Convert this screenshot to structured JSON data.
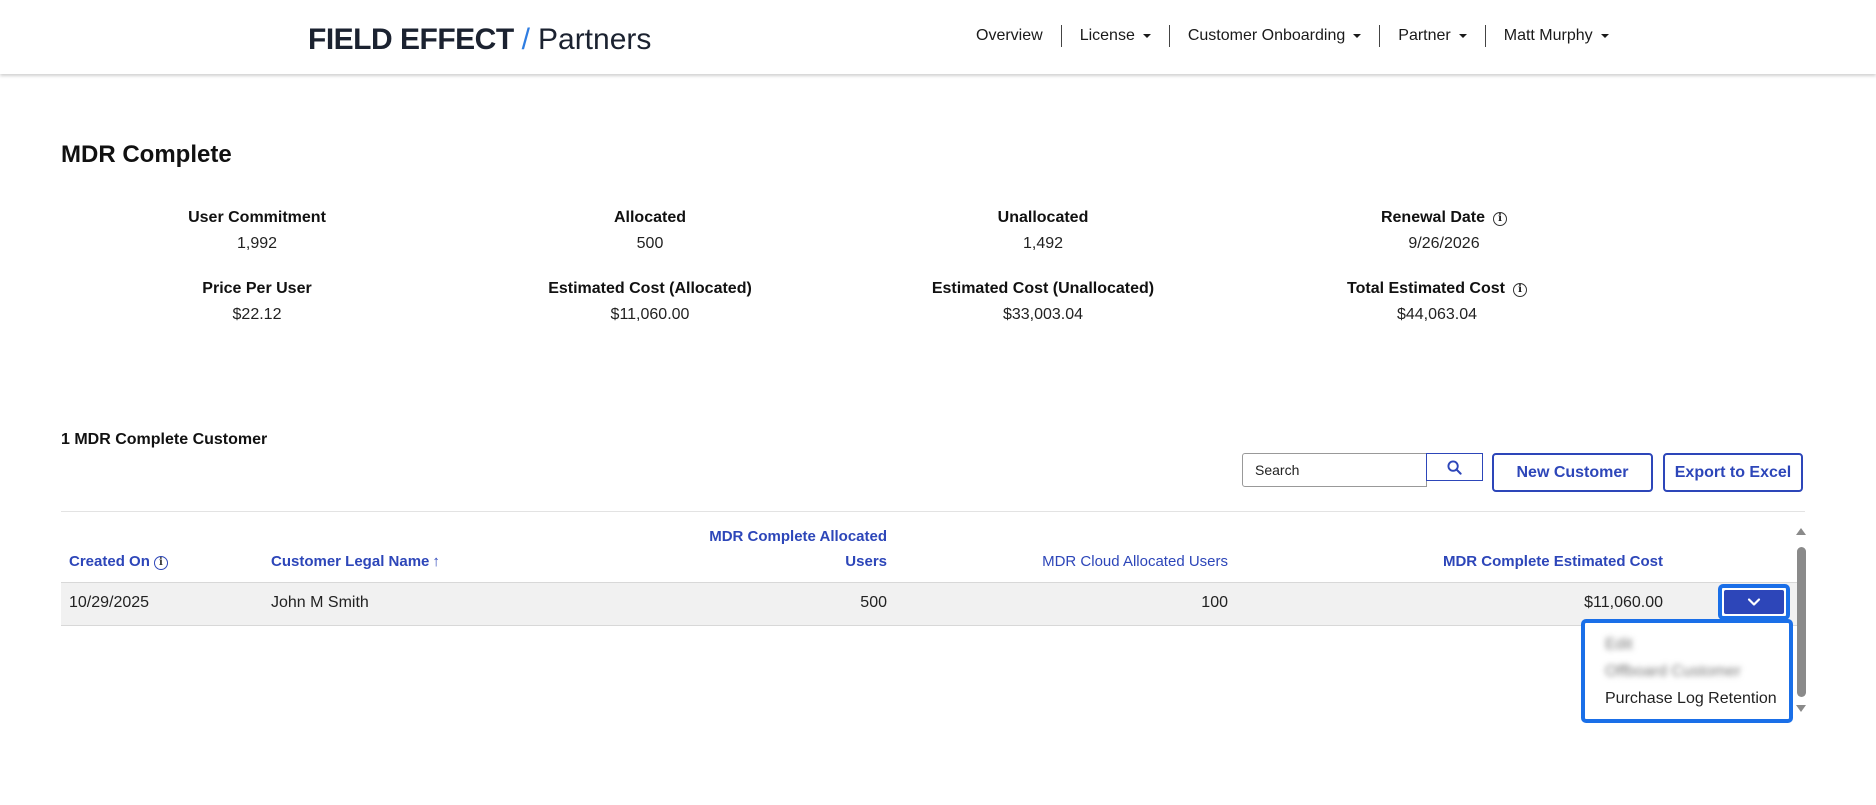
{
  "header": {
    "brand": "FIELD EFFECT",
    "slash": "/",
    "brand_sub": "Partners",
    "nav": [
      {
        "label": "Overview",
        "has_caret": false
      },
      {
        "label": "License",
        "has_caret": true
      },
      {
        "label": "Customer Onboarding",
        "has_caret": true
      },
      {
        "label": "Partner",
        "has_caret": true
      },
      {
        "label": "Matt Murphy",
        "has_caret": true
      }
    ]
  },
  "page": {
    "title": "MDR Complete"
  },
  "stats": {
    "user_commitment": {
      "label": "User Commitment",
      "value": "1,992"
    },
    "allocated": {
      "label": "Allocated",
      "value": "500"
    },
    "unallocated": {
      "label": "Unallocated",
      "value": "1,492"
    },
    "renewal_date": {
      "label": "Renewal Date",
      "value": "9/26/2026"
    },
    "price_per_user": {
      "label": "Price Per User",
      "value": "$22.12"
    },
    "est_cost_allocated": {
      "label": "Estimated Cost (Allocated)",
      "value": "$11,060.00"
    },
    "est_cost_unallocated": {
      "label": "Estimated Cost (Unallocated)",
      "value": "$33,003.04"
    },
    "total_est_cost": {
      "label": "Total Estimated Cost",
      "value": "$44,063.04"
    }
  },
  "customers": {
    "section_title": "1 MDR Complete Customer",
    "search_value": "Search",
    "new_customer_label": "New Customer",
    "export_label": "Export to Excel",
    "columns": {
      "created_on": "Created On",
      "legal_name": "Customer Legal Name",
      "sort_arrow": "↑",
      "mdr_complete_users_line1": "MDR Complete Allocated",
      "mdr_complete_users_line2": "Users",
      "mdr_cloud_users": "MDR Cloud Allocated Users",
      "est_cost": "MDR Complete Estimated Cost"
    },
    "rows": [
      {
        "created_on": "10/29/2025",
        "legal_name": "John M Smith",
        "mdr_complete_users": "500",
        "mdr_cloud_users": "100",
        "est_cost": "$11,060.00"
      }
    ],
    "row_menu": {
      "items": [
        "Edit",
        "Offboard Customer",
        "Purchase Log Retention"
      ]
    }
  },
  "icons": {
    "info": "info-icon",
    "search": "search-icon",
    "chevron": "chevron-down-icon"
  },
  "colors": {
    "accent": "#2d46b9",
    "focus": "#1a6fe8",
    "logo_slash": "#2f7de1"
  }
}
